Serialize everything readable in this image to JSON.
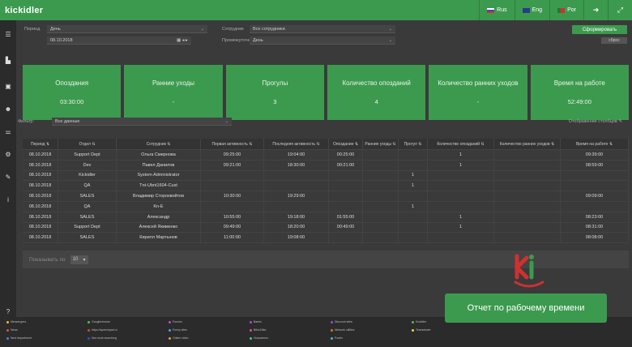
{
  "app": {
    "logo": "kickidler",
    "languages": [
      "Rus",
      "Eng",
      "Por"
    ]
  },
  "filters": {
    "period_label": "Период",
    "period_value": "День",
    "date_value": "08.10.2018",
    "employees_label": "Сотрудник",
    "employees_value": "Все сотрудники",
    "schedule_label": "Промежуточно",
    "schedule_value": "День",
    "generate_button": "Сформировать",
    "reset_button": "сброс"
  },
  "cards": [
    {
      "title": "Опоздания",
      "value": "03:30:00"
    },
    {
      "title": "Ранние уходы",
      "value": "-"
    },
    {
      "title": "Прогулы",
      "value": "3"
    },
    {
      "title": "Количество опозданий",
      "value": "4"
    },
    {
      "title": "Количество ранних уходов",
      "value": "-"
    },
    {
      "title": "Время на работе",
      "value": "52:49:00"
    }
  ],
  "filter": {
    "label": "Фильтр:",
    "value": "Все данные",
    "columns_toggle": "Отображение столбцов"
  },
  "table": {
    "headers": [
      "Период",
      "Отдел",
      "Сотрудник",
      "Первая активность",
      "Последняя активность",
      "Опоздание",
      "Ранние уходы",
      "Прогул",
      "Количество опозданий",
      "Количество ранних уходов",
      "Время на работе"
    ],
    "rows": [
      [
        "08.10.2018",
        "Support Dept",
        "Ольга Смирнова",
        "09:25:00",
        "19:04:00",
        "00:25:00",
        "",
        "",
        "1",
        "",
        "09:39:00"
      ],
      [
        "08.10.2018",
        "Dev",
        "Павел Данилов",
        "09:21:00",
        "18:30:00",
        "00:21:00",
        "",
        "",
        "1",
        "",
        "08:59:00"
      ],
      [
        "08.10.2018",
        "Kickidler",
        "System Administrator",
        "",
        "",
        "",
        "",
        "1",
        "",
        "",
        ""
      ],
      [
        "08.10.2018",
        "QA",
        "Tnt-Ubnt1604-Cust",
        "",
        "",
        "",
        "",
        "1",
        "",
        "",
        ""
      ],
      [
        "08.10.2018",
        "SALES",
        "Владимир Стороквойтов",
        "10:30:00",
        "19:29:00",
        "",
        "",
        "",
        "",
        "",
        "09:09:00"
      ],
      [
        "08.10.2018",
        "QA",
        "Kn-E",
        "",
        "",
        "",
        "",
        "1",
        "",
        "",
        ""
      ],
      [
        "08.10.2018",
        "SALES",
        "Александр",
        "10:55:00",
        "19:18:00",
        "01:55:00",
        "",
        "",
        "1",
        "",
        "08:23:00"
      ],
      [
        "08.10.2018",
        "Support Dept",
        "Алексей Якименко",
        "09:49:00",
        "18:20:00",
        "00:49:00",
        "",
        "",
        "1",
        "",
        "08:31:00"
      ],
      [
        "08.10.2018",
        "SALES",
        "Кирилл Мартынов",
        "11:00:00",
        "19:08:00",
        "",
        "",
        "",
        "",
        "",
        "08:08:00"
      ]
    ]
  },
  "pagination": {
    "label": "Показывать по",
    "value": "10"
  },
  "legend": [
    {
      "label": "Messengers",
      "color": "#e0c030"
    },
    {
      "label": "News",
      "color": "#e05050"
    },
    {
      "label": "Next department",
      "color": "#5080e0"
    },
    {
      "label": "Googlechrome",
      "color": "#50c050"
    },
    {
      "label": "https://speechpad.ru",
      "color": "#c05050"
    },
    {
      "label": "Non work searching",
      "color": "#3050c0"
    },
    {
      "label": "Forums",
      "color": "#c050c0"
    },
    {
      "label": "Funny sites",
      "color": "#50a0e0"
    },
    {
      "label": "Online video",
      "color": "#e0a030"
    },
    {
      "label": "Banks",
      "color": "#a050e0"
    },
    {
      "label": "Bitrix24ke",
      "color": "#e05090"
    },
    {
      "label": "Hosoaremo",
      "color": "#50c0a0"
    },
    {
      "label": "Discount sites",
      "color": "#9050e0"
    },
    {
      "label": "Network utilities",
      "color": "#e07030"
    },
    {
      "label": "Poster",
      "color": "#50b0e0"
    },
    {
      "label": "Kickidler",
      "color": "#50c050"
    },
    {
      "label": "Teamviewer",
      "color": "#e0e050"
    }
  ],
  "popup": {
    "text": "Отчет по рабочему времени"
  }
}
